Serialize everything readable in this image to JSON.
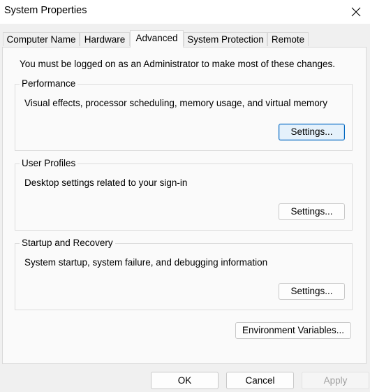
{
  "window": {
    "title": "System Properties"
  },
  "tabs": [
    {
      "label": "Computer Name"
    },
    {
      "label": "Hardware"
    },
    {
      "label": "Advanced",
      "active": true
    },
    {
      "label": "System Protection"
    },
    {
      "label": "Remote"
    }
  ],
  "advanced": {
    "intro": "You must be logged on as an Administrator to make most of these changes.",
    "performance": {
      "label": "Performance",
      "description": "Visual effects, processor scheduling, memory usage, and virtual memory",
      "button": "Settings..."
    },
    "user_profiles": {
      "label": "User Profiles",
      "description": "Desktop settings related to your sign-in",
      "button": "Settings..."
    },
    "startup_recovery": {
      "label": "Startup and Recovery",
      "description": "System startup, system failure, and debugging information",
      "button": "Settings..."
    },
    "env_button": "Environment Variables..."
  },
  "footer": {
    "ok": "OK",
    "cancel": "Cancel",
    "apply": "Apply"
  },
  "colors": {
    "focus_border": "#0067c0",
    "focus_fill": "#e5f1fb",
    "panel": "#fafafa",
    "window": "#f0f0f0"
  },
  "icons": {
    "close": "close-icon"
  }
}
